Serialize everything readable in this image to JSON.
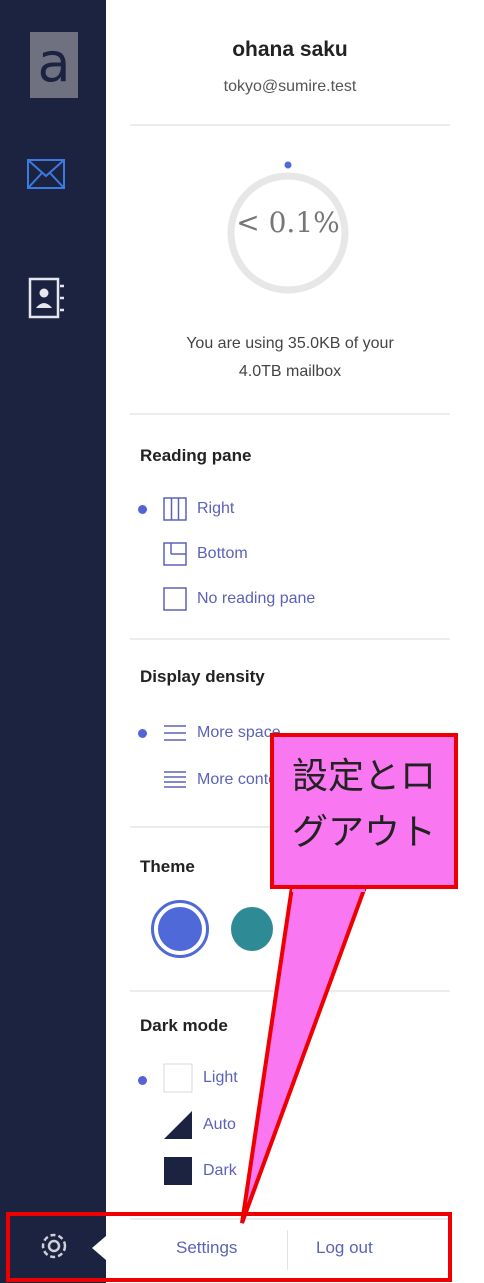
{
  "sidebar": {
    "logo_letter": "a"
  },
  "user": {
    "name": "ohana saku",
    "email": "tokyo@sumire.test"
  },
  "storage": {
    "percent_label": "< 0.1%",
    "used": "35.0KB",
    "total": "4.0TB",
    "description": "You are using 35.0KB of your 4.0TB mailbox",
    "line1": "You are using 35.0KB of your",
    "line2": "4.0TB mailbox"
  },
  "reading_pane": {
    "title": "Reading pane",
    "options": [
      "Right",
      "Bottom",
      "No reading pane"
    ],
    "selected": "Right"
  },
  "display_density": {
    "title": "Display density",
    "options": [
      "More space",
      "More content"
    ],
    "selected": "More space"
  },
  "theme": {
    "title": "Theme",
    "colors": [
      "#4f69d9",
      "#2e8b95",
      "#7a7a7a"
    ],
    "selected": "#4f69d9"
  },
  "dark_mode": {
    "title": "Dark mode",
    "options": [
      "Light",
      "Auto",
      "Dark"
    ],
    "selected": "Light"
  },
  "footer": {
    "settings_label": "Settings",
    "logout_label": "Log out"
  },
  "annotation": {
    "callout_line1": "設定とロ",
    "callout_line2": "グアウト",
    "callout_color": "#f977f0",
    "border_color": "#ee0000"
  }
}
